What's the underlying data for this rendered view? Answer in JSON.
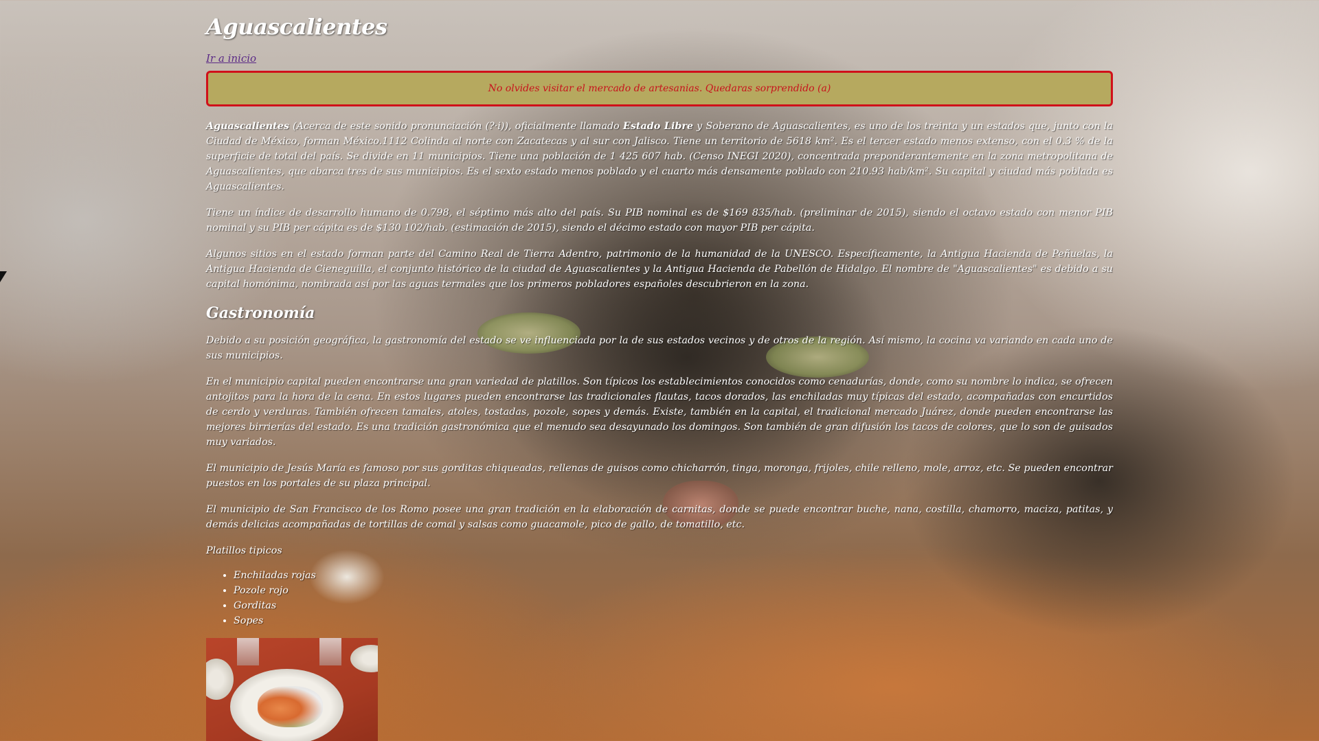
{
  "page": {
    "title": "Aguascalientes",
    "home_link": "Ir a inicio",
    "alert": "No olvides visitar el mercado de artesanias. Quedaras sorprendido (a)"
  },
  "intro": {
    "p1": {
      "bold1": "Aguascalientes",
      "t1": " (Acerca de este sonido pronunciación (?·i)), oficialmente llamado ",
      "bold2": "Estado Libre",
      "t2": " y Soberano de Aguascalientes, es uno de los treinta y un estados que, junto con la Ciudad de México, forman México.1112 Colinda al norte con Zacatecas y al sur con Jalisco. Tiene un territorio de 5618 km². Es el tercer estado menos extenso, con el 0.3 % de la superficie de total del país. Se divide en 11 municipios. Tiene una población de 1 425 607 hab. (Censo INEGI 2020), concentrada preponderantemente en la zona metropolitana de Aguascalientes, que abarca tres de sus municipios. Es el sexto estado menos poblado y el cuarto más densamente poblado con 210.93 hab/km². Su capital y ciudad más poblada es Aguascalientes."
    },
    "p2": "Tiene un índice de desarrollo humano de 0.798, el séptimo más alto del país. Su PIB nominal es de $169 835/hab. (preliminar de 2015), siendo el octavo estado con menor PIB nominal y su PIB per cápita es de $130 102/hab. (estimación de 2015), siendo el décimo estado con mayor PIB per cápita.",
    "p3": "Algunos sitios en el estado forman parte del Camino Real de Tierra Adentro, patrimonio de la humanidad de la UNESCO. Específicamente, la Antigua Hacienda de Peñuelas, la Antigua Hacienda de Cieneguilla, el conjunto histórico de la ciudad de Aguascalientes y la Antigua Hacienda de Pabellón de Hidalgo. El nombre de \"Aguascalientes\" es debido a su capital homónima, nombrada así por las aguas termales que los primeros pobladores españoles descubrieron en la zona."
  },
  "gastronomia": {
    "heading": "Gastronomía",
    "p1": "Debido a su posición geográfica, la gastronomía del estado se ve influenciada por la de sus estados vecinos y de otros de la región. Así mismo, la cocina va variando en cada uno de sus municipios.",
    "p2": "En el municipio capital pueden encontrarse una gran variedad de platillos. Son típicos los establecimientos conocidos como cenadurías, donde, como su nombre lo indica, se ofrecen antojitos para la hora de la cena. En estos lugares pueden encontrarse las tradicionales flautas, tacos dorados, las enchiladas muy típicas del estado, acompañadas con encurtidos de cerdo y verduras. También ofrecen tamales, atoles, tostadas, pozole, sopes y demás. Existe, también en la capital, el tradicional mercado Juárez, donde pueden encontrarse las mejores birrierías del estado. Es una tradición gastronómica que el menudo sea desayunado los domingos. Son también de gran difusión los tacos de colores, que lo son de guisados muy variados.",
    "p3": "El municipio de Jesús María es famoso por sus gorditas chiqueadas, rellenas de guisos como chicharrón, tinga, moronga, frijoles, chile relleno, mole, arroz, etc. Se pueden encontrar puestos en los portales de su plaza principal.",
    "p4": "El municipio de San Francisco de los Romo posee una gran tradición en la elaboración de carnitas, donde se puede encontrar buche, nana, costilla, chamorro, maciza, patitas, y demás delicias acompañadas de tortillas de comal y salsas como guacamole, pico de gallo, de tomatillo, etc.",
    "platillos_title": "Platillos tipicos",
    "platillos": [
      "Enchiladas rojas",
      "Pozole rojo",
      "Gorditas",
      "Sopes"
    ]
  },
  "colors": {
    "alert_bg": "#b6a95f",
    "alert_border": "#d0101a",
    "alert_text": "#c8121c",
    "link": "#5b2a86",
    "text": "#ffffff"
  }
}
